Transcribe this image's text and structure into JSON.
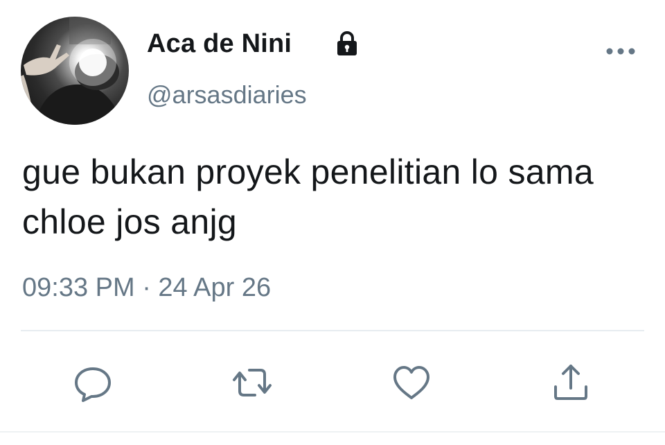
{
  "tweet": {
    "display_name": "Aca de Nini",
    "handle": "@arsasdiaries",
    "text": "gue bukan proyek penelitian lo sama chloe jos anjg",
    "timestamp": "09:33 PM · 24 Apr 26",
    "protected_icon": "lock-icon",
    "more_icon": "more-horizontal-icon"
  },
  "actions": [
    {
      "name": "reply",
      "icon": "comment-bubble-icon"
    },
    {
      "name": "retweet",
      "icon": "retweet-arrows-icon"
    },
    {
      "name": "like",
      "icon": "heart-icon"
    },
    {
      "name": "share",
      "icon": "share-upload-icon"
    }
  ],
  "colors": {
    "primary_text": "#14171a",
    "secondary_text": "#657786",
    "icon": "#657786",
    "divider": "#e6ecf0"
  }
}
